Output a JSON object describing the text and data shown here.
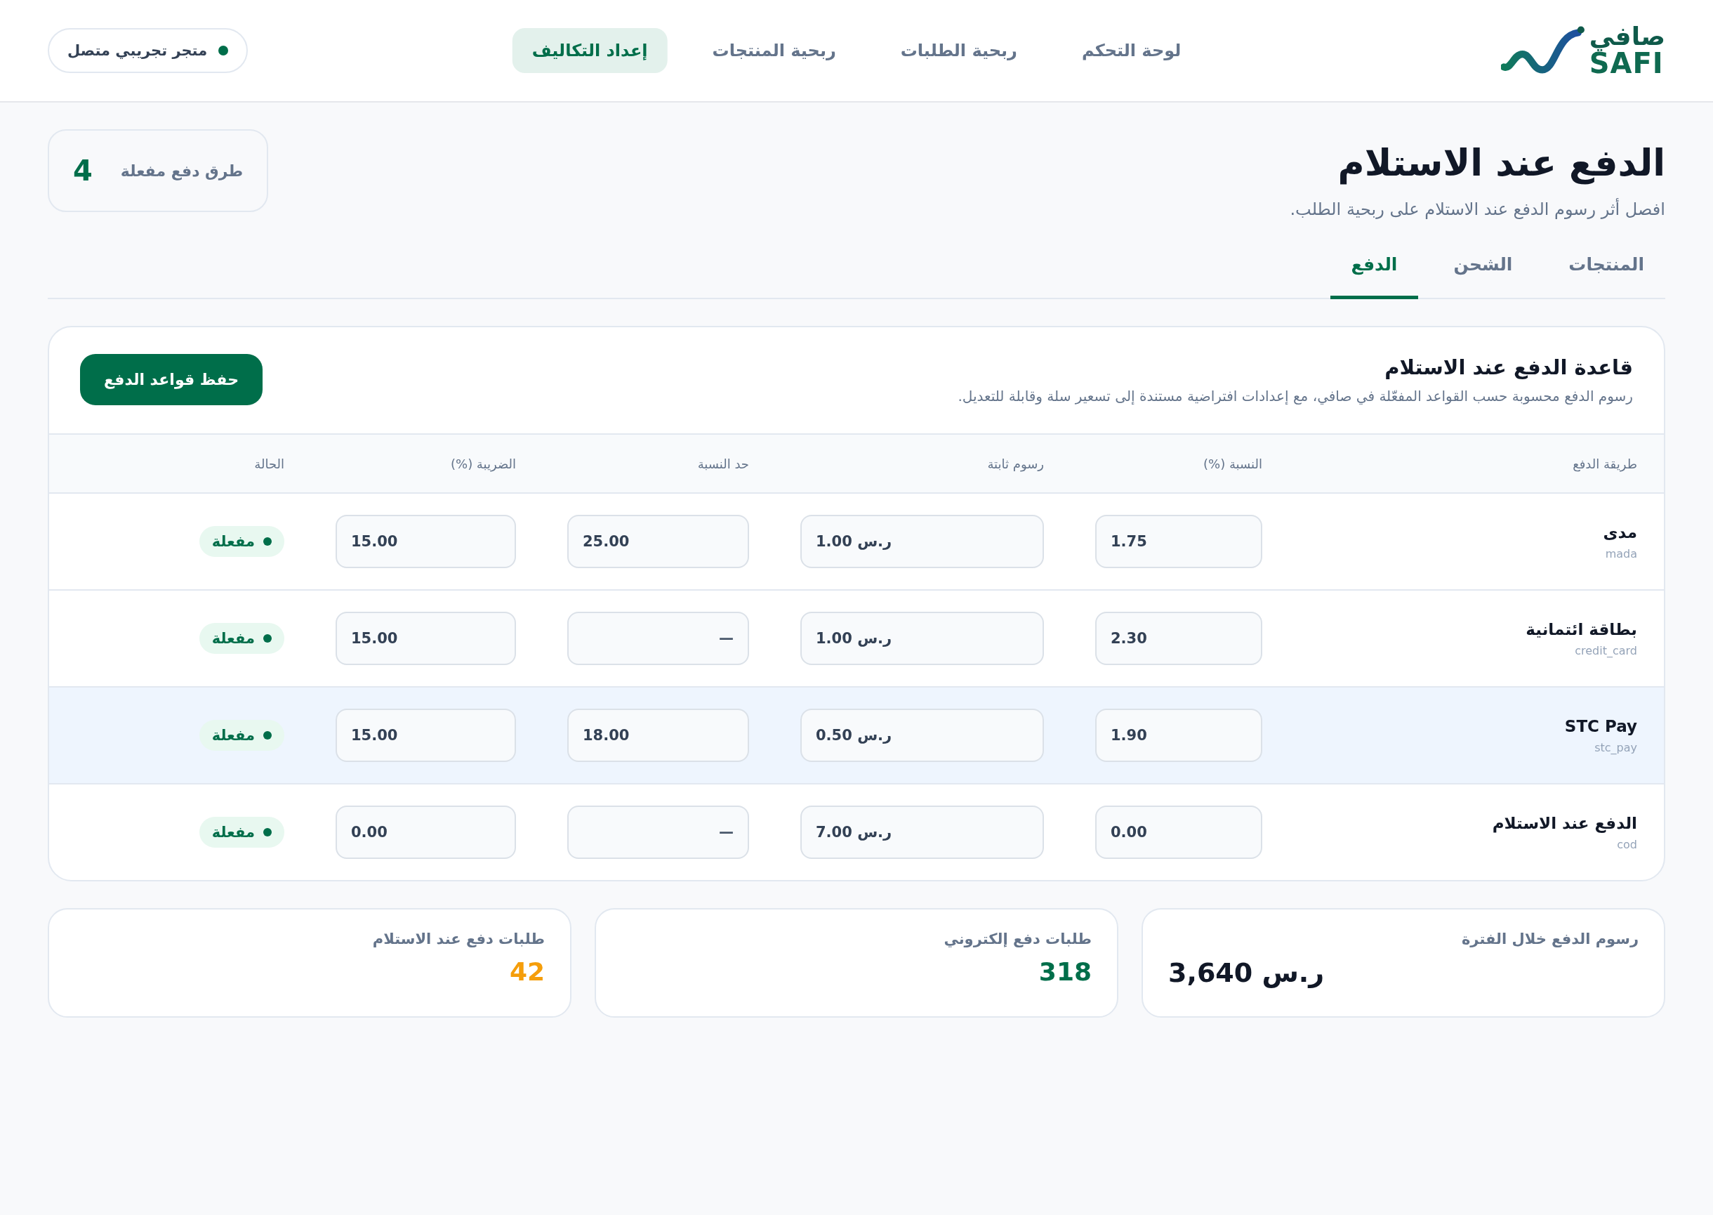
{
  "logo": {
    "arabic": "صافي",
    "latin": "SAFI"
  },
  "nav": [
    {
      "label": "لوحة التحكم",
      "selected": false
    },
    {
      "label": "ربحية الطلبات",
      "selected": false
    },
    {
      "label": "ربحية المنتجات",
      "selected": false
    },
    {
      "label": "إعداد التكاليف",
      "selected": true
    }
  ],
  "store": {
    "label": "متجر تجريبي متصل",
    "connected": true
  },
  "page": {
    "title": "الدفع عند الاستلام",
    "subtitle": "افصل أثر رسوم الدفع عند الاستلام على ربحية الطلب.",
    "stat": {
      "label": "طرق دفع مفعلة",
      "value": "4"
    }
  },
  "tabs": [
    {
      "label": "المنتجات",
      "selected": false
    },
    {
      "label": "الشحن",
      "selected": false
    },
    {
      "label": "الدفع",
      "selected": true
    }
  ],
  "rules": {
    "title": "قاعدة الدفع عند الاستلام",
    "description": "رسوم الدفع محسوبة حسب القواعد المفعّلة في صافي، مع إعدادات افتراضية مستندة إلى تسعير سلة وقابلة للتعديل.",
    "save_button": "حفظ قواعد الدفع",
    "columns": [
      "طريقة الدفع",
      "النسبة (%)",
      "رسوم ثابتة",
      "حد النسبة",
      "الضريبة (%)",
      "الحالة"
    ],
    "rows": [
      {
        "name": "مدى",
        "code": "mada",
        "rate": "1.75",
        "fixed": "1.00 ر.س",
        "cap": "25.00",
        "tax": "15.00",
        "status": "مفعلة",
        "active": true,
        "highlighted": false
      },
      {
        "name": "بطاقة ائتمانية",
        "code": "credit_card",
        "rate": "2.30",
        "fixed": "1.00 ر.س",
        "cap_placeholder": "—",
        "tax": "15.00",
        "status": "مفعلة",
        "active": true,
        "highlighted": false
      },
      {
        "name": "STC Pay",
        "code": "stc_pay",
        "rate": "1.90",
        "fixed": "0.50 ر.س",
        "cap": "18.00",
        "tax": "15.00",
        "status": "مفعلة",
        "active": true,
        "highlighted": true
      },
      {
        "name": "الدفع عند الاستلام",
        "code": "cod",
        "rate": "0.00",
        "fixed": "7.00 ر.س",
        "cap_placeholder": "—",
        "tax": "0.00",
        "status": "مفعلة",
        "active": true,
        "highlighted": false
      }
    ]
  },
  "stats": [
    {
      "label": "رسوم الدفع خلال الفترة",
      "value": "ر.س 3,640",
      "color": "#111827"
    },
    {
      "label": "طلبات دفع إلكتروني",
      "value": "318",
      "color": "#006e4a"
    },
    {
      "label": "طلبات دفع عند الاستلام",
      "value": "42",
      "color": "#f59e0b"
    }
  ]
}
